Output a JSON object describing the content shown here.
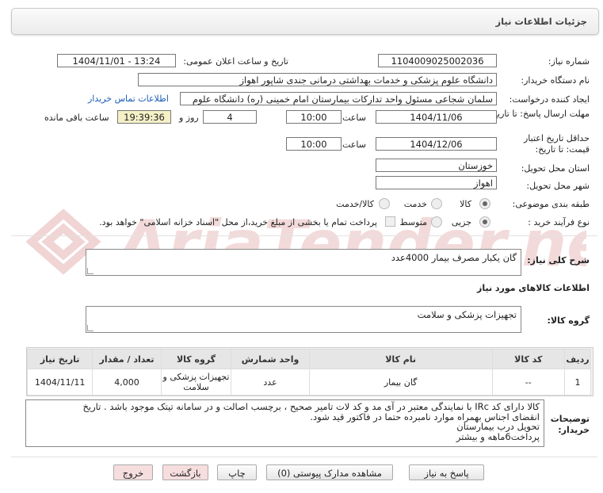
{
  "header": {
    "title": "جزئیات اطلاعات نیاز"
  },
  "watermark": {
    "text": "AriaTender.net"
  },
  "fields": {
    "need_number_label": "شماره نیاز:",
    "need_number": "1104009025002036",
    "announce_label": "تاریخ و ساعت اعلان عمومی:",
    "announce_value": "1404/11/01 - 13:24",
    "buyer_org_label": "نام دستگاه خریدار:",
    "buyer_org": "دانشگاه علوم پزشکی و خدمات بهداشتی درمانی جندی شاپور اهواز",
    "requester_label": "ایجاد کننده درخواست:",
    "requester": "سلمان شجاعی مسئول واحد تدارکات بیمارستان امام خمینی (ره) دانشگاه علوم",
    "contact_link": "اطلاعات تماس خریدار",
    "deadline_label": "مهلت ارسال پاسخ: تا تاریخ:",
    "deadline_date": "1404/11/06",
    "time_label": "ساعت",
    "deadline_time": "10:00",
    "days_value": "4",
    "days_label": "روز و",
    "remaining_time": "19:39:36",
    "remaining_label": "ساعت باقی مانده",
    "validity_label_1": "حداقل تاریخ اعتبار",
    "validity_label_2": "قیمت: تا تاریخ:",
    "validity_date": "1404/12/06",
    "validity_time": "10:00",
    "province_label": "استان محل تحویل:",
    "province": "خوزستان",
    "city_label": "شهر محل تحویل:",
    "city": "اهواز",
    "category_label": "طبقه بندی موضوعی:",
    "category_options": [
      "کالا",
      "خدمت",
      "کالا/خدمت"
    ],
    "process_label": "نوع فرآیند خرید :",
    "process_options": [
      "جزیی",
      "متوسط"
    ],
    "payment_note": "پرداخت تمام یا بخشی از مبلغ خرید،از محل \"اسناد خزانه اسلامی\" خواهد بود."
  },
  "description": {
    "label": "شرح کلی نیاز:",
    "value": "گان یکبار مصرف بیمار      4000عدد"
  },
  "goods_info": {
    "label": "اطلاعات کالاهای مورد نیاز"
  },
  "goods_group": {
    "label": "گروه کالا:",
    "value": "تجهیزات پزشکی و سلامت"
  },
  "table": {
    "headers": [
      "ردیف",
      "کد کالا",
      "نام کالا",
      "واحد شمارش",
      "گروه کالا",
      "تعداد / مقدار",
      "تاریخ نیاز"
    ],
    "rows": [
      [
        "1",
        "--",
        "گان بیمار",
        "عدد",
        "تجهیزات پزشکی و سلامت",
        "4,000",
        "1404/11/11"
      ]
    ]
  },
  "buyer_notes": {
    "label_1": "توضیحات",
    "label_2": "خریدار:",
    "lines": [
      "کالا دارای کد IRc با نمایندگی معتبر در آی مد و کد لات تامیر صحیح ، برچسب اصالت و در سامانه تیتک موجود باشد . تاریخ",
      "انقضای اجناس بهمراه موارد نامبرده حتما در فاکتور قید شود.",
      "تحویل درب بیمارستان",
      "پرداخت6ماهه و بیشتر"
    ]
  },
  "buttons": {
    "reply": "پاسخ به نیاز",
    "attachments": "مشاهده مدارک پیوستی (0)",
    "print": "چاپ",
    "back": "بازگشت",
    "exit": "خروج"
  }
}
